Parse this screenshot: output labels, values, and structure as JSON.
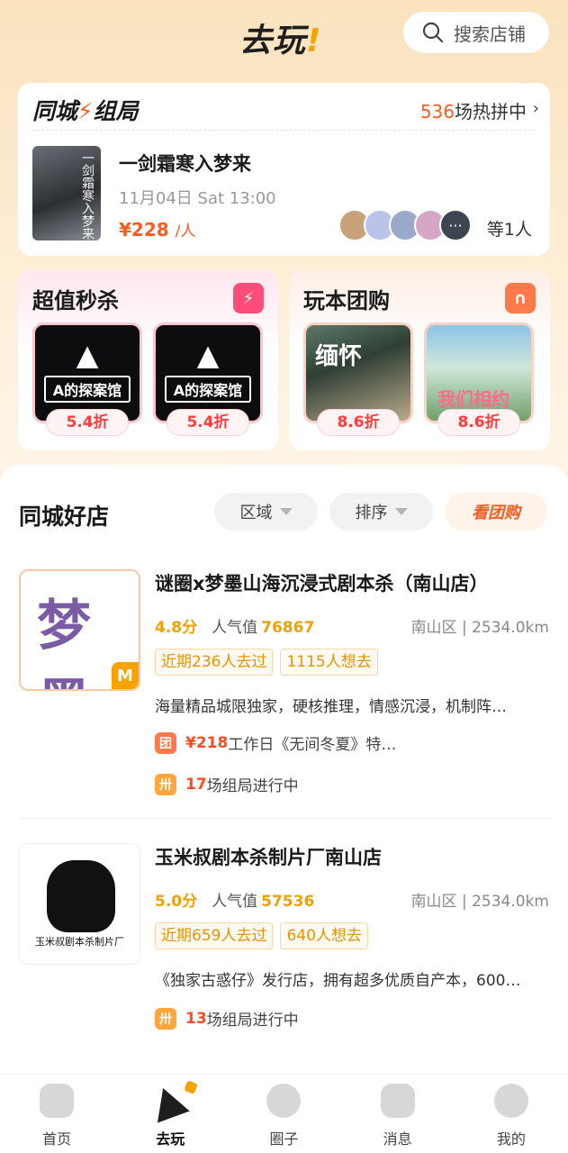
{
  "header": {
    "logo": "去玩",
    "logo_bang": "!",
    "search_placeholder": "搜索店铺"
  },
  "group_card": {
    "title_a": "同城",
    "title_b": "组局",
    "count": "536",
    "count_suffix": "场热拼中",
    "event": {
      "poster_text": "一剑霜寒入梦来",
      "title": "一剑霜寒入梦来",
      "time": "11月04日 Sat 13:00",
      "price": "¥228",
      "unit": "/人",
      "more_label": "等1人",
      "more_dots": "···"
    }
  },
  "promos": [
    {
      "title": "超值秒杀",
      "icon_color": "#ff4d79",
      "items": [
        {
          "emblem": "▲",
          "label": "A的探案馆",
          "discount": "5.4折"
        },
        {
          "emblem": "▲",
          "label": "A的探案馆",
          "discount": "5.4折"
        }
      ]
    },
    {
      "title": "玩本团购",
      "icon_color": "#ff7a4a",
      "items": [
        {
          "label": "缅怀",
          "discount": "8.6折"
        },
        {
          "label": "我们相约",
          "discount": "8.6折"
        }
      ]
    }
  ],
  "shops_section": {
    "title": "同城好店",
    "filters": {
      "area": "区域",
      "sort": "排序",
      "group_buy": "看团购"
    }
  },
  "shops": [
    {
      "logo_mark": "梦墨",
      "logo_badge": "M",
      "name": "谜圈x梦墨山海沉浸式剧本杀（南山店）",
      "score": "4.8分",
      "hot_label": "人气值",
      "hot_value": "76867",
      "distance": "南山区 | 2534.0km",
      "tags": [
        "近期236人去过",
        "1115人想去"
      ],
      "desc": "海量精品城限独家，硬核推理，情感沉浸，机制阵…",
      "deal_icon": "团",
      "deal_price": "¥218",
      "deal_text": "工作日《无间冬夏》特…",
      "group_icon": "卅",
      "group_count": "17",
      "group_text": "场组局进行中"
    },
    {
      "logo_caption": "玉米叔剧本杀制片厂",
      "name": "玉米叔剧本杀制片厂南山店",
      "score": "5.0分",
      "hot_label": "人气值",
      "hot_value": "57536",
      "distance": "南山区 | 2534.0km",
      "tags": [
        "近期659人去过",
        "640人想去"
      ],
      "desc": "《独家古惑仔》发行店，拥有超多优质自产本，600…",
      "group_icon": "卅",
      "group_count": "13",
      "group_text": "场组局进行中"
    }
  ],
  "tabbar": {
    "items": [
      {
        "label": "首页"
      },
      {
        "label": "去玩"
      },
      {
        "label": "圈子"
      },
      {
        "label": "消息"
      },
      {
        "label": "我的"
      }
    ]
  },
  "colors": {
    "accent": "#ff5a1f",
    "brand_yellow": "#f6a300",
    "score_orange": "#f2a000"
  }
}
